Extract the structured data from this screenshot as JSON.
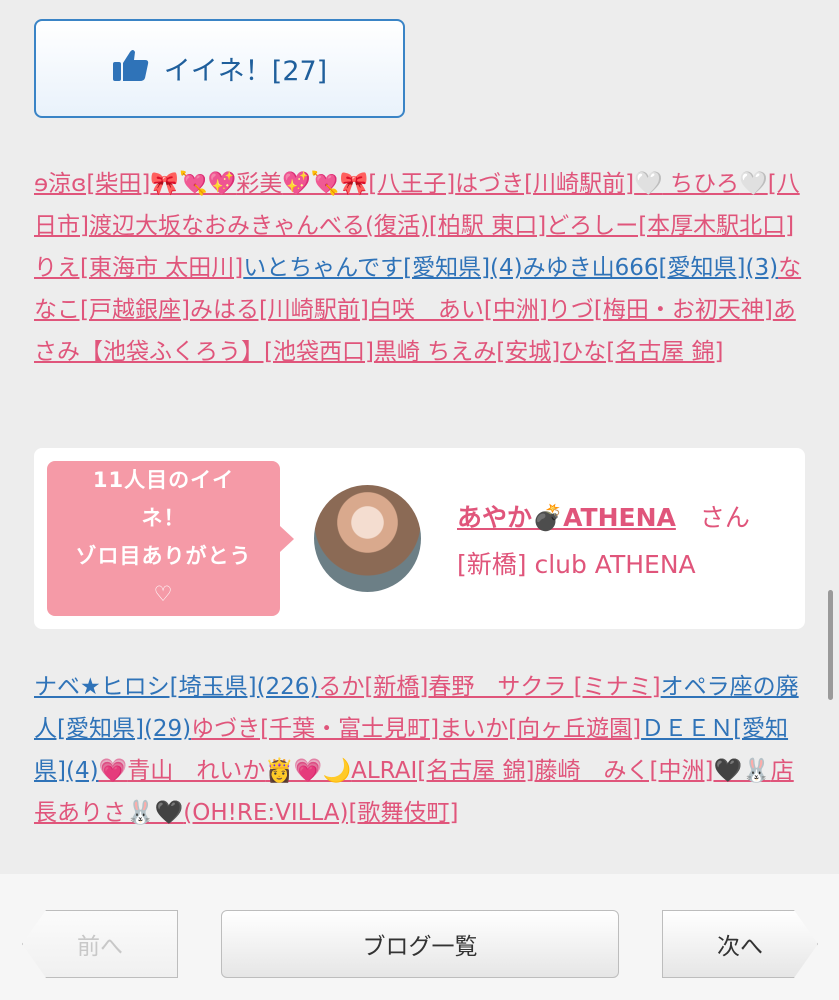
{
  "like_button": {
    "label": "イイネ！[27]",
    "icon": "thumbs-up-icon"
  },
  "names_top": [
    {
      "t": "ɘ涼ɞ[柴田]",
      "c": "pink"
    },
    {
      "t": "🎀💘💖",
      "c": "pink",
      "emoji": true
    },
    {
      "t": "彩美",
      "c": "pink"
    },
    {
      "t": "💖💘🎀",
      "c": "pink",
      "emoji": true
    },
    {
      "t": "[八王子]",
      "c": "pink"
    },
    {
      "t": "はづき[川崎駅前]",
      "c": "pink"
    },
    {
      "t": "🤍",
      "c": "pink",
      "emoji": true
    },
    {
      "t": " ちひろ",
      "c": "pink"
    },
    {
      "t": "🤍",
      "c": "pink",
      "emoji": true
    },
    {
      "t": "[八日市]",
      "c": "pink"
    },
    {
      "t": "渡辺大坂なおみきゃんべる(復活)[柏駅 東口]",
      "c": "pink"
    },
    {
      "t": "どろしー[本厚木駅北口]",
      "c": "pink"
    },
    {
      "t": "りえ[東海市 太田川]",
      "c": "pink"
    },
    {
      "t": "いとちゃんです[愛知県](4)",
      "c": "blue"
    },
    {
      "t": "みゆき山666[愛知県](3)",
      "c": "blue"
    },
    {
      "t": "ななこ[戸越銀座]",
      "c": "pink"
    },
    {
      "t": "みはる[川崎駅前]",
      "c": "pink"
    },
    {
      "t": "白咲　あい[中洲]",
      "c": "pink"
    },
    {
      "t": "りづ[梅田・お初天神]",
      "c": "pink"
    },
    {
      "t": "あさみ【池袋ふくろう】[池袋西口]",
      "c": "pink"
    },
    {
      "t": "黒崎 ちえみ[安城]",
      "c": "pink"
    },
    {
      "t": "ひな[名古屋 錦]",
      "c": "pink"
    }
  ],
  "milestone_card": {
    "bubble_line1": "11人目のイイ",
    "bubble_line2": "ネ！",
    "bubble_line3": "ゾロ目ありがとう",
    "bubble_heart": "♡",
    "name": "あやか💣ATHENA",
    "honorific": "さん",
    "shop": "[新橋] club ATHENA"
  },
  "names_bottom": [
    {
      "t": "ナベ★ヒロシ[埼玉県](226)",
      "c": "blue"
    },
    {
      "t": "るか[新橋]",
      "c": "pink"
    },
    {
      "t": "春野　サクラ [ミナミ]",
      "c": "pink"
    },
    {
      "t": "オペラ座の廃人[愛知県](29)",
      "c": "blue"
    },
    {
      "t": "ゆづき[千葉・富士見町]",
      "c": "pink"
    },
    {
      "t": "まいか[向ヶ丘遊園]",
      "c": "pink"
    },
    {
      "t": "ＤＥＥＮ[愛知県](4)",
      "c": "blue"
    },
    {
      "t": "💗",
      "c": "pink",
      "emoji": true
    },
    {
      "t": "青山　れいか",
      "c": "pink"
    },
    {
      "t": "👸💗🌙",
      "c": "pink",
      "emoji": true
    },
    {
      "t": "ALRAI[名古屋 錦]",
      "c": "pink"
    },
    {
      "t": "藤崎　みく[中洲]",
      "c": "pink"
    },
    {
      "t": "🖤🐰",
      "c": "pink",
      "emoji": true
    },
    {
      "t": "店長ありさ",
      "c": "pink"
    },
    {
      "t": "🐰🖤",
      "c": "pink",
      "emoji": true
    },
    {
      "t": "(OH!RE:VILLA)[歌舞伎町]",
      "c": "pink"
    }
  ],
  "footer": {
    "prev": "前へ",
    "list": "ブログ一覧",
    "next": "次へ"
  },
  "colors": {
    "pink": "#e0557b",
    "blue": "#2f73b8",
    "bubble": "#f59aa7",
    "like_border": "#3a84c6"
  }
}
